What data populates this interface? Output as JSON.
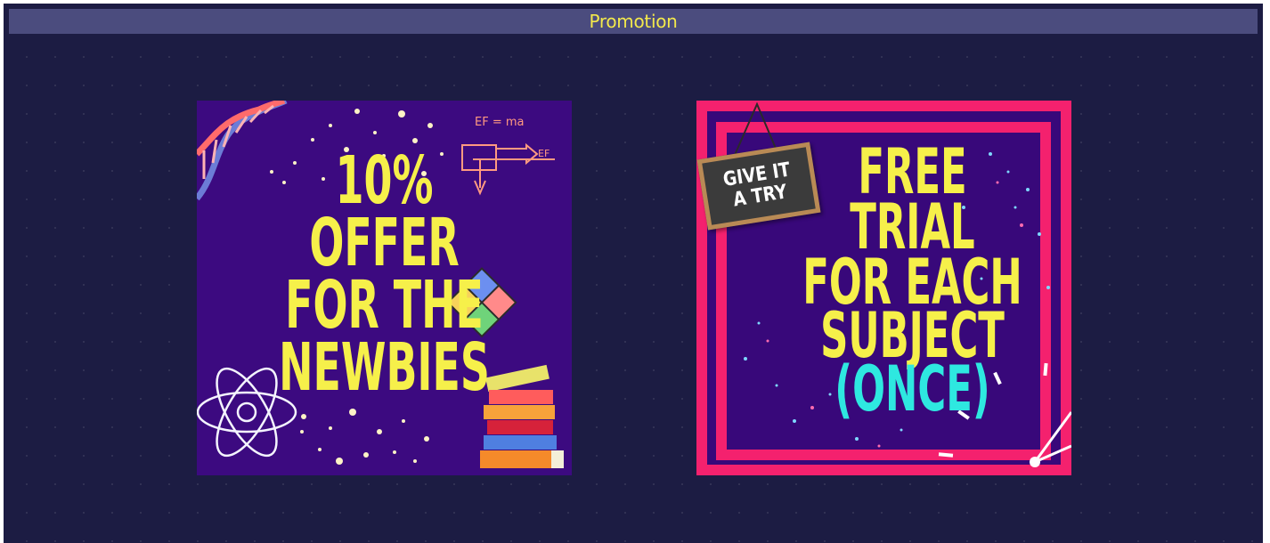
{
  "header": {
    "title": "Promotion"
  },
  "promotions": [
    {
      "lines": [
        "10%",
        "OFFER",
        "FOR THE",
        "NEWBIES"
      ],
      "formula": "EF = ma",
      "vector_label": "EF"
    },
    {
      "sign_lines": [
        "GIVE IT",
        "A TRY"
      ],
      "lines": [
        "FREE",
        "TRIAL",
        "FOR EACH",
        "SUBJECT",
        "(ONCE)"
      ]
    }
  ],
  "colors": {
    "background": "#1c1c43",
    "title_bar": "#4b4c7e",
    "title_text": "#f3e94b",
    "card_purple": "#3c0a80",
    "headline_yellow": "#f6f04a",
    "accent_pink": "#f4216e",
    "accent_cyan": "#2ee8e0"
  }
}
